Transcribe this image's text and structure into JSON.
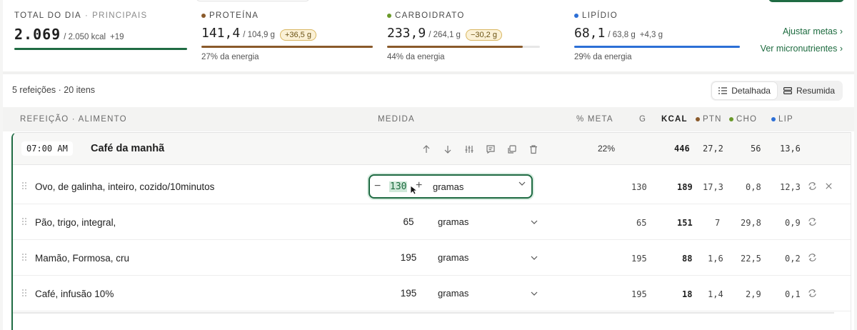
{
  "summary": {
    "total": {
      "label": "TOTAL DO DIA",
      "sublabel": "PRINCIPAIS",
      "value": "2.069",
      "goal": "/ 2.050 kcal",
      "delta": "+19",
      "progress": 1.0,
      "color": "#1f6b43"
    },
    "protein": {
      "label": "PROTEÍNA",
      "value": "141,4",
      "goal": "/ 104,9 g",
      "badge": "+36,5 g",
      "note": "27% da energia",
      "progress": 1.0,
      "color": "#8a5a2b"
    },
    "carbs": {
      "label": "CARBOIDRATO",
      "value": "233,9",
      "goal": "/ 264,1 g",
      "badge": "−30,2 g",
      "note": "44% da energia",
      "progress": 0.886,
      "color": "#8a5a2b",
      "dot_color": "#6a9a2a"
    },
    "fat": {
      "label": "LIPÍDIO",
      "value": "68,1",
      "goal": "/ 63,8 g",
      "delta": "+4,3 g",
      "note": "29% da energia",
      "progress": 1.0,
      "color": "#2c6fd6"
    },
    "links": {
      "adjust_goals": "Ajustar metas ›",
      "micronutrients": "Ver micronutrientes ›"
    }
  },
  "meta": {
    "count": "5 refeições · 20 itens",
    "view_detailed": "Detalhada",
    "view_summary": "Resumida"
  },
  "table": {
    "headers": {
      "meal_food": "REFEIÇÃO · ALIMENTO",
      "measure": "MEDIDA",
      "pct_goal": "% META",
      "g": "G",
      "kcal": "KCAL",
      "ptn": "PTN",
      "cho": "CHO",
      "lip": "LIP"
    },
    "meal": {
      "time": "07:00 AM",
      "name": "Café da manhã",
      "pct": "22%",
      "kcal": "446",
      "ptn": "27,2",
      "cho": "56",
      "lip": "13,6"
    },
    "rows": [
      {
        "name": "Ovo, de galinha, inteiro, cozido/10minutos",
        "qty": "130",
        "unit": "gramas",
        "g": "130",
        "kcal": "189",
        "ptn": "17,3",
        "cho": "0,8",
        "lip": "12,3"
      },
      {
        "name": "Pão, trigo, integral,",
        "qty": "65",
        "unit": "gramas",
        "g": "65",
        "kcal": "151",
        "ptn": "7",
        "cho": "29,8",
        "lip": "0,9"
      },
      {
        "name": "Mamão, Formosa, cru",
        "qty": "195",
        "unit": "gramas",
        "g": "195",
        "kcal": "88",
        "ptn": "1,6",
        "cho": "22,5",
        "lip": "0,2"
      },
      {
        "name": "Café, infusão 10%",
        "qty": "195",
        "unit": "gramas",
        "g": "195",
        "kcal": "18",
        "ptn": "1,4",
        "cho": "2,9",
        "lip": "0,1"
      }
    ]
  },
  "colors": {
    "accent": "#1f6b43",
    "protein": "#8a5a2b",
    "carbs": "#6a9a2a",
    "fat": "#2c6fd6"
  }
}
